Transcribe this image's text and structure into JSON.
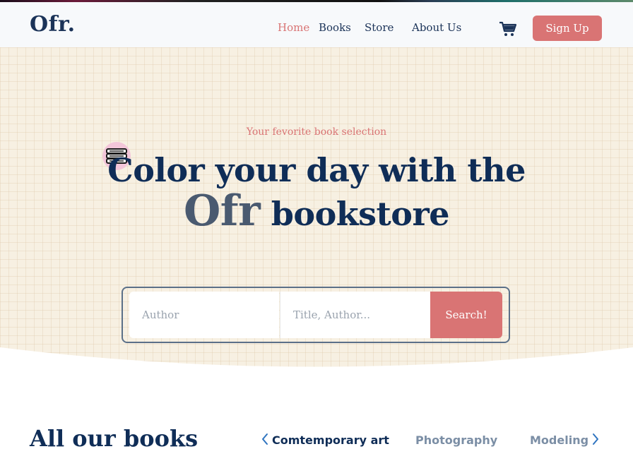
{
  "header": {
    "logo": "Ofr.",
    "nav": [
      "Home",
      "Books",
      "Store",
      "About Us"
    ],
    "active_nav": "Home",
    "cart_icon": "shopping-cart-icon",
    "signup_label": "Sign Up"
  },
  "hero": {
    "subtitle": "Your fevorite book selection",
    "headline_line1": "Color your day with the",
    "headline_ofr": "Ofr",
    "headline_line2_rest": "bookstore",
    "badge_icon": "books-stack-icon"
  },
  "search": {
    "author_placeholder": "Author",
    "title_placeholder": "Title, Author...",
    "button_label": "Search!"
  },
  "books_section": {
    "title": "All our books",
    "categories": [
      "Comtemporary art",
      "Photography",
      "Modeling"
    ],
    "active_category": "Comtemporary art",
    "prev_icon": "chevron-left-icon",
    "next_icon": "chevron-right-icon"
  },
  "colors": {
    "accent": "#d97474",
    "navy": "#0f2d57",
    "hero_bg": "#f7f0e2"
  }
}
